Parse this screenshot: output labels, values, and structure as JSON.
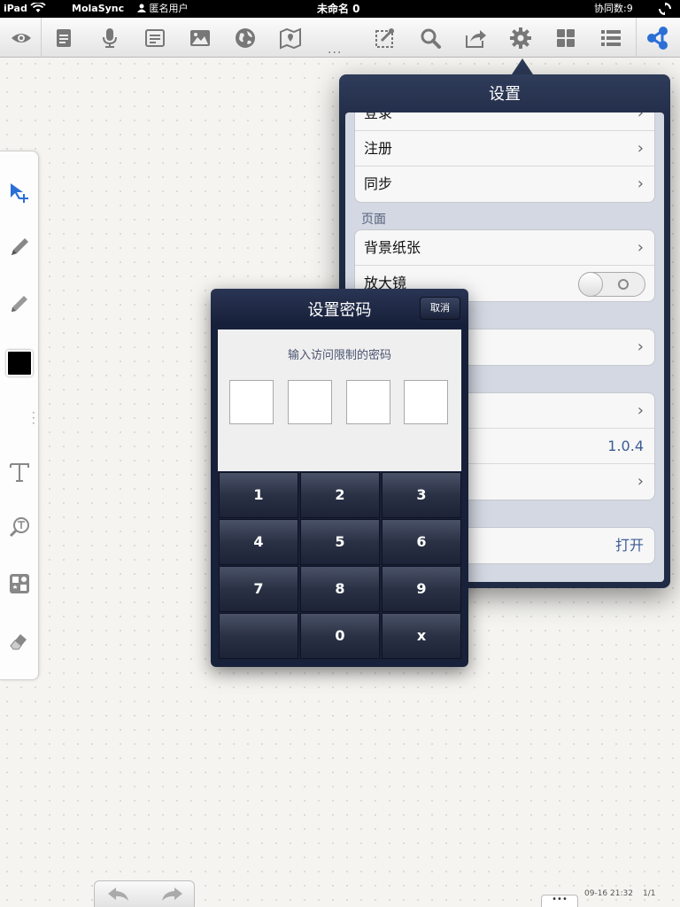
{
  "status_bar": {
    "device": "iPad",
    "app_name": "MolaSync",
    "user": "匿名用户",
    "doc_title": "未命名 0",
    "collaborators": "协同数:9"
  },
  "toolbar": {
    "more": "..."
  },
  "settings": {
    "title": "设置",
    "account_rows": [
      {
        "label": "登录"
      },
      {
        "label": "注册"
      },
      {
        "label": "同步"
      }
    ],
    "page_header": "页面",
    "page_rows": [
      {
        "label": "背景纸张"
      },
      {
        "label": "放大镜"
      }
    ],
    "version": "1.0.4",
    "last_value": "打开"
  },
  "password_dialog": {
    "title": "设置密码",
    "cancel_label": "取消",
    "prompt": "输入访问限制的密码",
    "keys": [
      "1",
      "2",
      "3",
      "4",
      "5",
      "6",
      "7",
      "8",
      "9",
      "",
      "0",
      "x"
    ]
  },
  "bottom": {
    "more": "•••",
    "timestamp": "09-16 21:32",
    "page": "1/1"
  }
}
